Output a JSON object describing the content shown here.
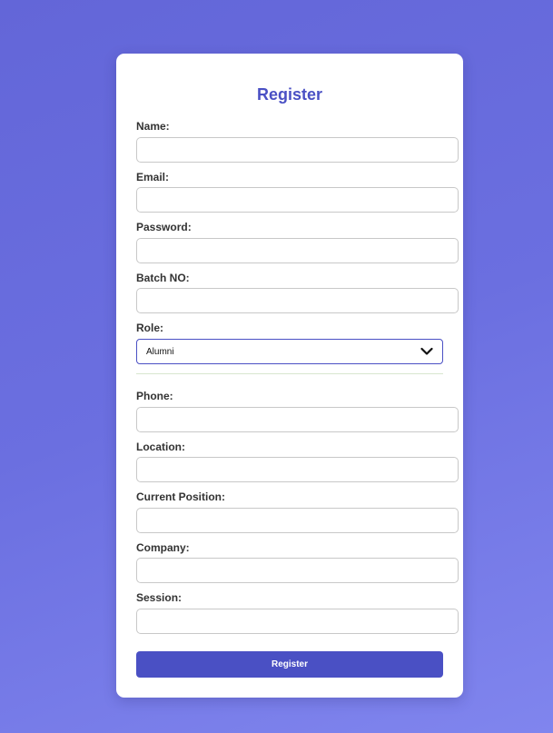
{
  "form": {
    "title": "Register",
    "fields": {
      "name": {
        "label": "Name:",
        "value": ""
      },
      "email": {
        "label": "Email:",
        "value": ""
      },
      "password": {
        "label": "Password:",
        "value": ""
      },
      "batch_no": {
        "label": "Batch NO:",
        "value": ""
      },
      "role": {
        "label": "Role:",
        "selected": "Alumni"
      },
      "phone": {
        "label": "Phone:",
        "value": ""
      },
      "location": {
        "label": "Location:",
        "value": ""
      },
      "current_position": {
        "label": "Current Position:",
        "value": ""
      },
      "company": {
        "label": "Company:",
        "value": ""
      },
      "session": {
        "label": "Session:",
        "value": ""
      }
    },
    "submit_label": "Register"
  },
  "colors": {
    "accent": "#4a50c4",
    "background_start": "#6366d8",
    "background_end": "#8085ee",
    "card": "#ffffff",
    "divider": "#d8e6cf"
  },
  "icons": {
    "role_dropdown": "chevron-down-icon"
  }
}
